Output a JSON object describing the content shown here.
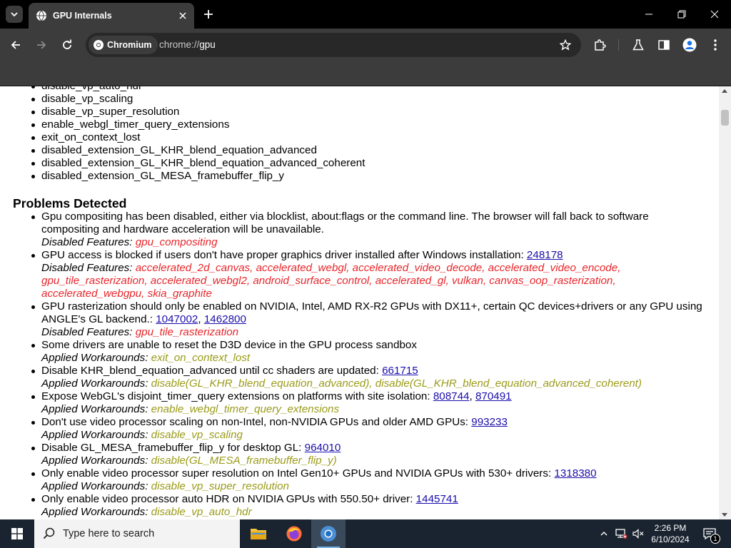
{
  "browser": {
    "tab_title": "GPU Internals",
    "chip_label": "Chromium",
    "url_scheme": "chrome://",
    "url_path": "gpu"
  },
  "page": {
    "workarounds_tail": [
      "disable_vp_auto_hdr",
      "disable_vp_scaling",
      "disable_vp_super_resolution",
      "enable_webgl_timer_query_extensions",
      "exit_on_context_lost",
      "disabled_extension_GL_KHR_blend_equation_advanced",
      "disabled_extension_GL_KHR_blend_equation_advanced_coherent",
      "disabled_extension_GL_MESA_framebuffer_flip_y"
    ],
    "problems_heading": "Problems Detected",
    "disabled_features_label": "Disabled Features:",
    "applied_workarounds_label": "Applied Workarounds:",
    "problems": [
      {
        "text": "Gpu compositing has been disabled, either via blocklist, about:flags or the command line. The browser will fall back to software compositing and hardware acceleration will be unavailable.",
        "features": "gpu_compositing"
      },
      {
        "text": "GPU access is blocked if users don't have proper graphics driver installed after Windows installation:",
        "link1": "248178",
        "features": "accelerated_2d_canvas, accelerated_webgl, accelerated_video_decode, accelerated_video_encode, gpu_tile_rasterization, accelerated_webgl2, android_surface_control, accelerated_gl, vulkan, canvas_oop_rasterization, accelerated_webgpu, skia_graphite"
      },
      {
        "text": "GPU rasterization should only be enabled on NVIDIA, Intel, AMD RX-R2 GPUs with DX11+, certain QC devices+drivers or any GPU using ANGLE's GL backend.:",
        "link1": "1047002",
        "link2": "1462800",
        "features": "gpu_tile_rasterization"
      },
      {
        "text": "Some drivers are unable to reset the D3D device in the GPU process sandbox",
        "workarounds": "exit_on_context_lost"
      },
      {
        "text": "Disable KHR_blend_equation_advanced until cc shaders are updated:",
        "link1": "661715",
        "workarounds": "disable(GL_KHR_blend_equation_advanced), disable(GL_KHR_blend_equation_advanced_coherent)"
      },
      {
        "text": "Expose WebGL's disjoint_timer_query extensions on platforms with site isolation:",
        "link1": "808744",
        "link2": "870491",
        "workarounds": "enable_webgl_timer_query_extensions"
      },
      {
        "text": "Don't use video processor scaling on non-Intel, non-NVIDIA GPUs and older AMD GPUs:",
        "link1": "993233",
        "workarounds": "disable_vp_scaling"
      },
      {
        "text": "Disable GL_MESA_framebuffer_flip_y for desktop GL:",
        "link1": "964010",
        "workarounds": "disable(GL_MESA_framebuffer_flip_y)"
      },
      {
        "text": "Only enable video processor super resolution on Intel Gen10+ GPUs and NVIDIA GPUs with 530+ drivers:",
        "link1": "1318380",
        "workarounds": "disable_vp_super_resolution"
      },
      {
        "text": "Only enable video processor auto HDR on NVIDIA GPUs with 550.50+ driver:",
        "link1": "1445741",
        "workarounds": "disable_vp_auto_hdr"
      }
    ]
  },
  "taskbar": {
    "search_placeholder": "Type here to search",
    "time": "2:26 PM",
    "date": "6/10/2024",
    "notification_count": "1"
  },
  "colors": {
    "feature_red": "#e8262b",
    "workaround_olive": "#9b9b1a",
    "link_blue": "#1a0dab",
    "toolbar": "#3c3c3c"
  }
}
